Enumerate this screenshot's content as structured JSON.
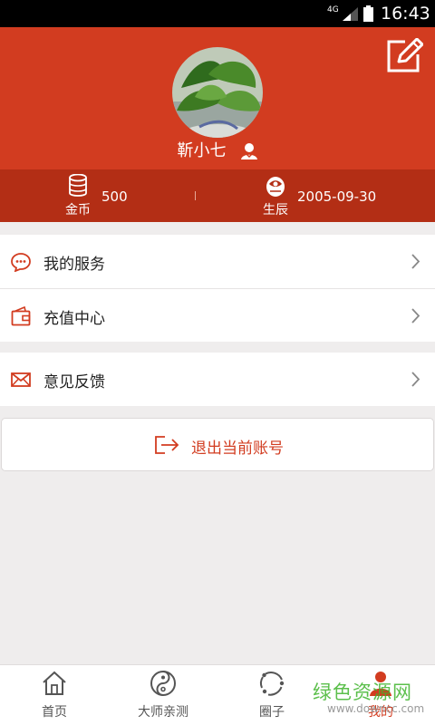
{
  "status_bar": {
    "network": "4G",
    "time": "16:43"
  },
  "profile": {
    "nickname": "靳小七"
  },
  "stats": {
    "coins": {
      "label": "金币",
      "value": "500"
    },
    "birth": {
      "label": "生辰",
      "value": "2005-09-30"
    }
  },
  "menu": {
    "services": "我的服务",
    "recharge": "充值中心",
    "feedback": "意见反馈"
  },
  "logout": {
    "label": "退出当前账号"
  },
  "tabbar": {
    "tabs": [
      {
        "label": "首页",
        "icon": "home-icon"
      },
      {
        "label": "大师亲测",
        "icon": "taiji-icon"
      },
      {
        "label": "圈子",
        "icon": "circle-icon"
      },
      {
        "label": "我的",
        "icon": "person-icon"
      }
    ],
    "active_index": 3
  },
  "watermark": {
    "text": "绿色资源网",
    "url": "www.downcc.com"
  },
  "colors": {
    "primary": "#d23c20",
    "stats_bar": "#b32e15",
    "background": "#efeded"
  }
}
